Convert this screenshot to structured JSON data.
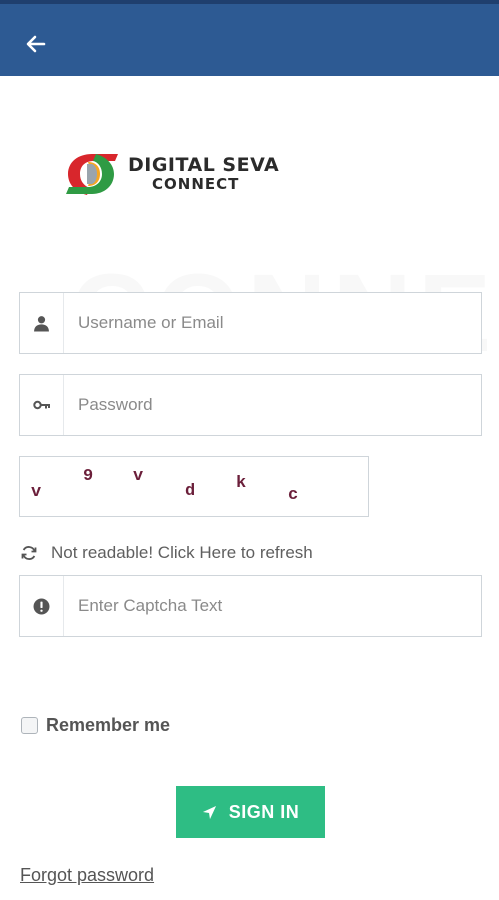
{
  "header": {
    "back_icon": "arrow-left-icon",
    "bar_color": "#2d5a93"
  },
  "background": {
    "watermark": "CONNECT"
  },
  "logo": {
    "line1": "DIGITAL SEVA",
    "line2": "CONNECT"
  },
  "form": {
    "username": {
      "placeholder": "Username or Email",
      "value": "",
      "icon": "user-icon"
    },
    "password": {
      "placeholder": "Password",
      "value": "",
      "icon": "key-icon"
    },
    "captcha_image": {
      "chars": [
        "v",
        "9",
        "v",
        "d",
        "k",
        "c"
      ],
      "color": "#6b1f3a"
    },
    "refresh": {
      "label": "Not readable! Click Here to refresh",
      "icon": "refresh-icon"
    },
    "captcha_text": {
      "placeholder": "Enter Captcha Text",
      "value": "",
      "icon": "info-circle-icon"
    },
    "remember": {
      "label": "Remember me",
      "checked": false
    },
    "sign_in": {
      "label": "SIGN IN",
      "icon": "location-arrow-icon",
      "color": "#2ebd84"
    },
    "forgot": {
      "label": "Forgot password"
    }
  }
}
